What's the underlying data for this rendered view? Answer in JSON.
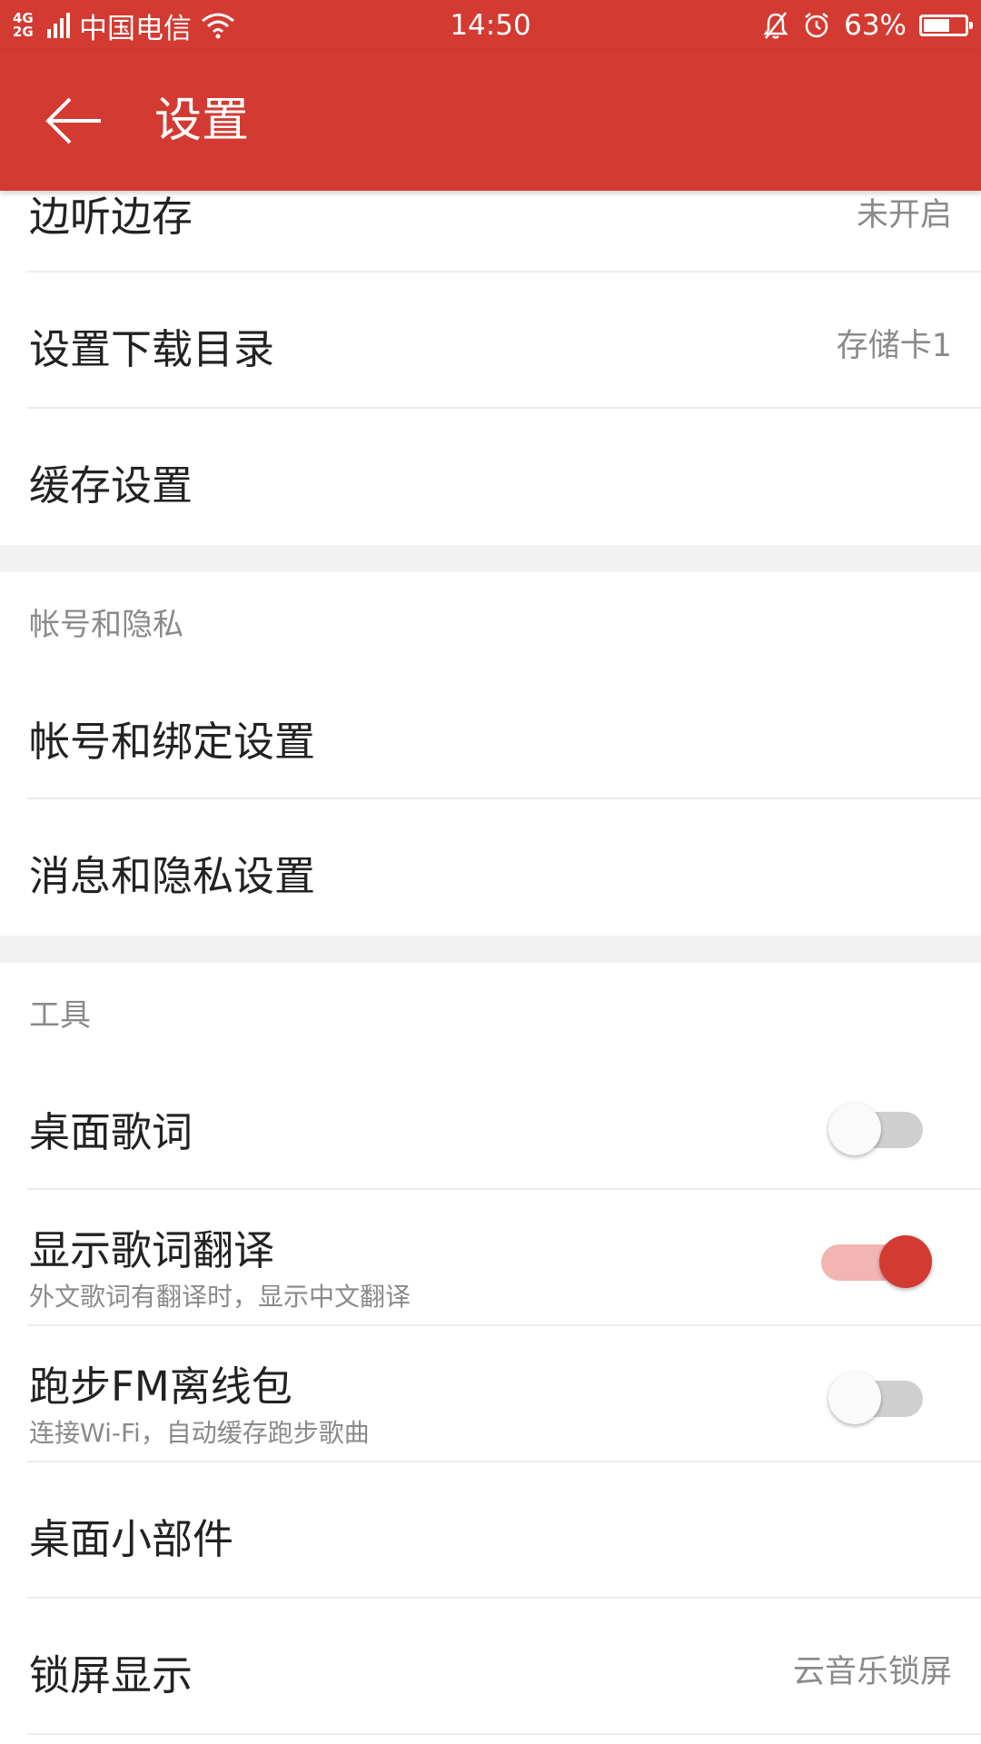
{
  "status_bar": {
    "network_top": "4G",
    "network_bottom": "2G",
    "carrier": "中国电信",
    "time": "14:50",
    "battery_percent_label": "63%",
    "battery_level": 0.63,
    "icons": [
      "signal-icon",
      "wifi-icon",
      "mute-bell-icon",
      "alarm-icon",
      "battery-icon"
    ]
  },
  "app_bar": {
    "title": "设置",
    "back_icon": "arrow-left-icon",
    "color": "#d33a31"
  },
  "rows": {
    "listen_save": {
      "label": "边听边存",
      "value": "未开启"
    },
    "download_dir": {
      "label": "设置下载目录",
      "value": "存储卡1"
    },
    "cache": {
      "label": "缓存设置"
    }
  },
  "sections": {
    "account": {
      "header": "帐号和隐私",
      "items": [
        {
          "label": "帐号和绑定设置"
        },
        {
          "label": "消息和隐私设置"
        }
      ]
    },
    "tools": {
      "header": "工具",
      "desktop_lyrics": {
        "label": "桌面歌词",
        "enabled": false
      },
      "lyrics_translation": {
        "label": "显示歌词翻译",
        "sub": "外文歌词有翻译时，显示中文翻译",
        "enabled": true
      },
      "running_fm": {
        "label": "跑步FM离线包",
        "sub": "连接Wi-Fi，自动缓存跑步歌曲",
        "enabled": false
      },
      "widget": {
        "label": "桌面小部件"
      },
      "lock_screen": {
        "label": "锁屏显示",
        "value": "云音乐锁屏"
      }
    }
  }
}
